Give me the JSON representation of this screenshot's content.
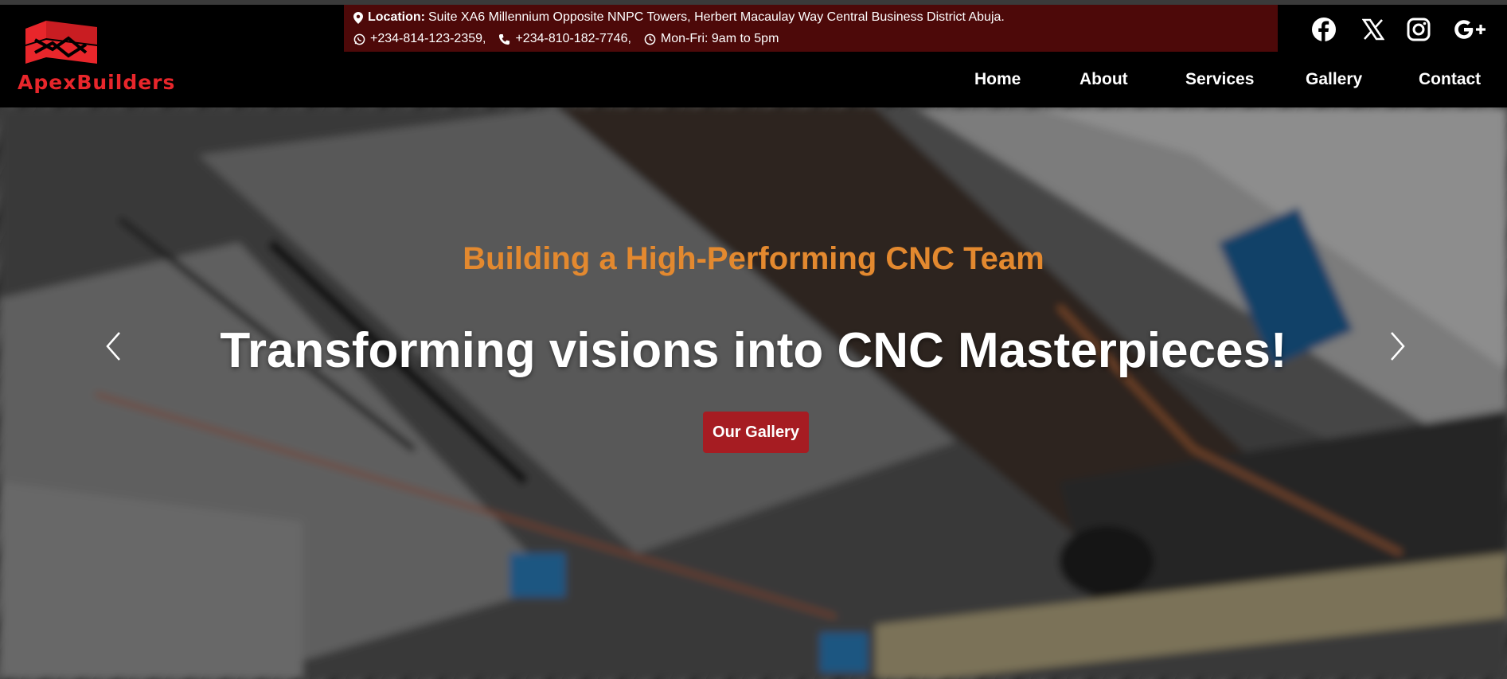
{
  "brand": {
    "name": "ApexBuilders",
    "logo_color": "#e8262b"
  },
  "topbar": {
    "location_label": "Location:",
    "location_text": "Suite XA6 Millennium Opposite NNPC Towers, Herbert Macaulay Way Central Business District Abuja.",
    "whatsapp": "+234-814-123-2359,",
    "phone": "+234-810-182-7746,",
    "hours": "Mon-Fri: 9am to 5pm",
    "background": "#4d0909"
  },
  "social": [
    "facebook-icon",
    "x-icon",
    "instagram-icon",
    "google-plus-icon"
  ],
  "nav": {
    "home": "Home",
    "about": "About",
    "services": "Services",
    "gallery": "Gallery",
    "contact": "Contact"
  },
  "hero": {
    "subtitle": "Building a High-Performing CNC Team",
    "headline": "Transforming visions into CNC Masterpieces!",
    "cta": "Our Gallery",
    "subtitle_color": "#e3892f",
    "cta_color": "#a61c22"
  }
}
